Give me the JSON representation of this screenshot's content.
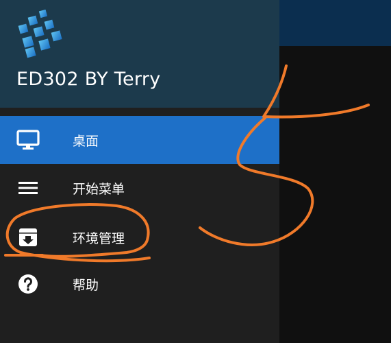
{
  "drawer": {
    "title": "ED302 BY Terry",
    "logo_icon": "cube-grid-logo-icon",
    "items": [
      {
        "label": "桌面",
        "icon": "monitor-icon",
        "active": true
      },
      {
        "label": "开始菜单",
        "icon": "menu-icon",
        "active": false
      },
      {
        "label": "环境管理",
        "icon": "archive-download-icon",
        "active": false
      },
      {
        "label": "帮助",
        "icon": "help-icon",
        "active": false
      }
    ]
  },
  "colors": {
    "drawer_header": "#1c3a4c",
    "drawer_body": "#1f1f1f",
    "active_item": "#1e70c8",
    "app_topbar": "#0b2e4f",
    "annotation_orange": "#f07a2a"
  },
  "annotation": {
    "handwritten_digit": "5"
  }
}
